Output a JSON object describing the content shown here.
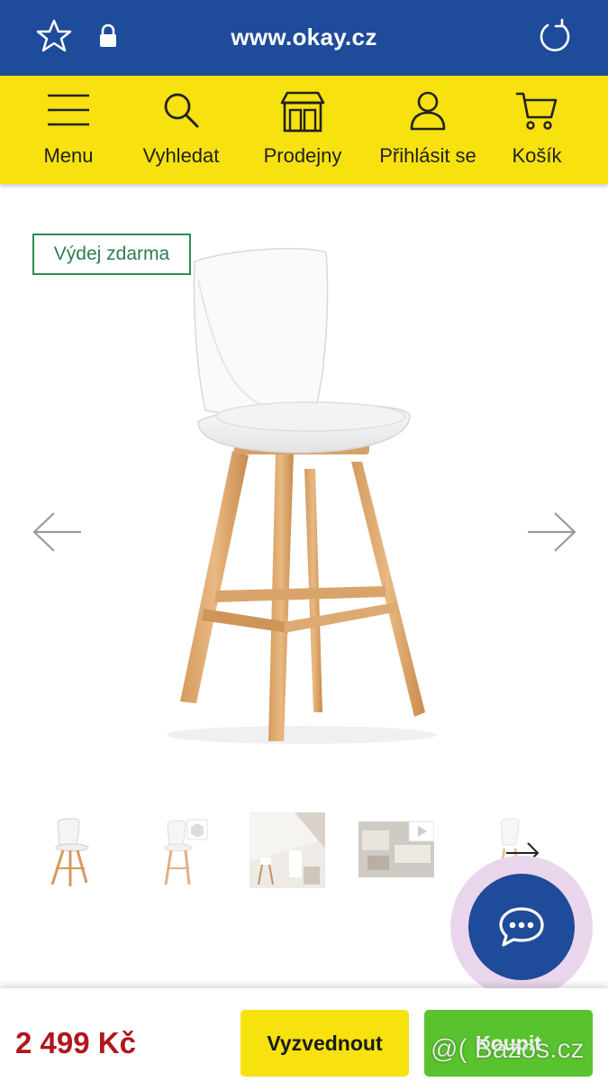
{
  "browser": {
    "url": "www.okay.cz",
    "icons": [
      "star-icon",
      "lock-icon",
      "reload-icon"
    ]
  },
  "nav": {
    "items": [
      {
        "label": "Menu",
        "icon": "hamburger-icon"
      },
      {
        "label": "Vyhledat",
        "icon": "search-icon"
      },
      {
        "label": "Prodejny",
        "icon": "store-icon"
      },
      {
        "label": "Přihlásit se",
        "icon": "user-icon"
      },
      {
        "label": "Košík",
        "icon": "cart-icon"
      }
    ]
  },
  "product": {
    "badge": "Výdej zdarma",
    "image": "white-bar-stool-with-wooden-legs",
    "thumbnail_count": 5
  },
  "bottom_bar": {
    "price": "2 499 Kč",
    "pickup_label": "Vyzvednout",
    "buy_label": "Koupit"
  },
  "watermark": "@( Bazos.cz",
  "colors": {
    "browser_bar": "#1e4b9a",
    "nav_bar": "#f7e10e",
    "badge_border": "#2e8b57",
    "price": "#b2161c",
    "pickup_button": "#f7e10e",
    "buy_button": "#58c32e",
    "chat_button": "#1e4b9a"
  }
}
